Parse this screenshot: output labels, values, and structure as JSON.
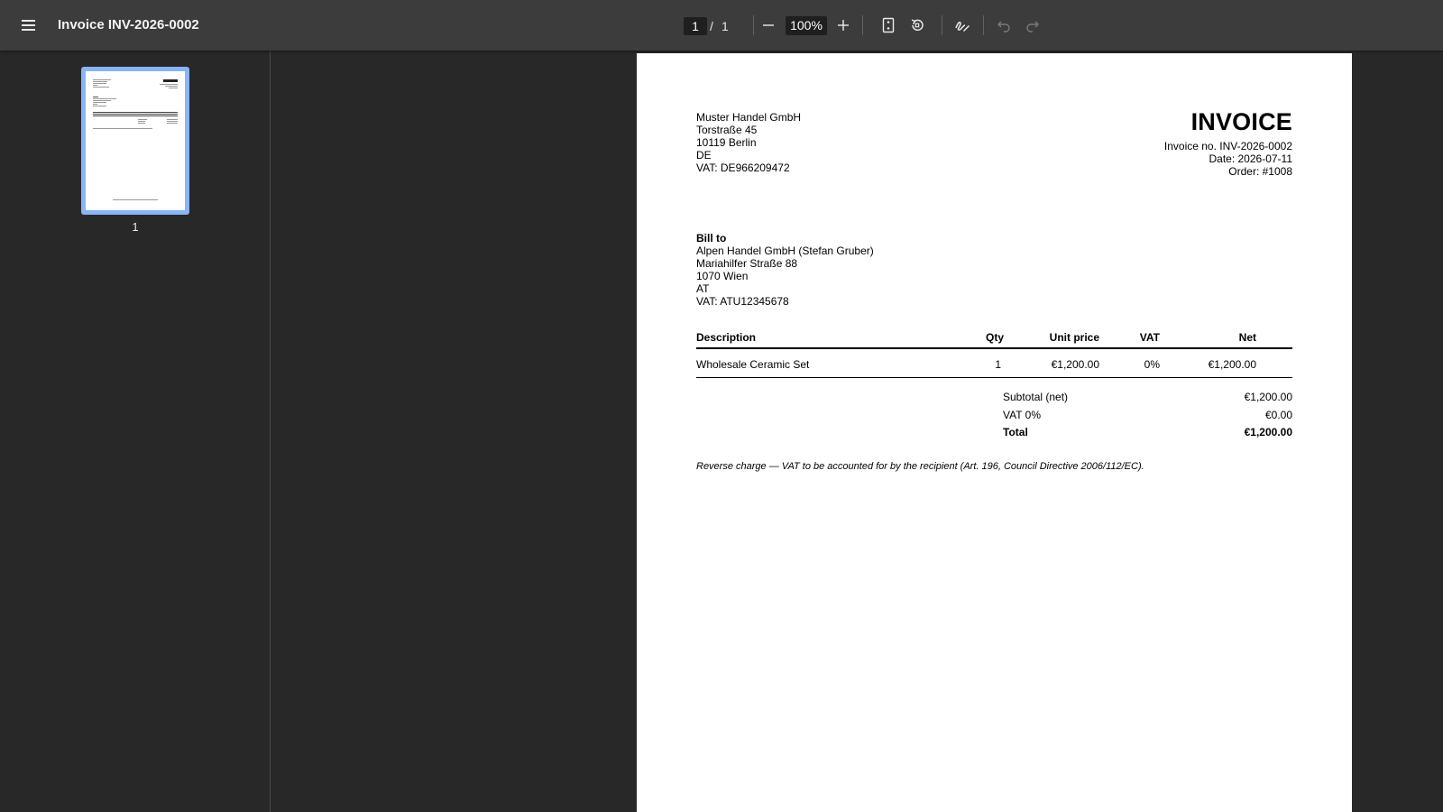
{
  "toolbar": {
    "title": "Invoice INV-2026-0002",
    "current_page": "1",
    "page_separator": "/",
    "total_pages": "1",
    "zoom": "100%"
  },
  "sidebar": {
    "thumbnails": [
      {
        "page_label": "1"
      }
    ]
  },
  "invoice": {
    "seller": {
      "name": "Muster Handel GmbH",
      "street": "Torstraße 45",
      "city": "10119 Berlin",
      "country": "DE",
      "vat": "VAT: DE966209472"
    },
    "title": "INVOICE",
    "meta": {
      "number": "Invoice no. INV-2026-0002",
      "date": "Date: 2026-07-11",
      "order": "Order: #1008"
    },
    "bill_to": {
      "heading": "Bill to",
      "name": "Alpen Handel GmbH (Stefan Gruber)",
      "street": "Mariahilfer Straße 88",
      "city": "1070 Wien",
      "country": "AT",
      "vat": "VAT: ATU12345678"
    },
    "table": {
      "headers": [
        "Description",
        "Qty",
        "Unit price",
        "VAT",
        "Net"
      ],
      "rows": [
        [
          "Wholesale Ceramic Set",
          "1",
          "€1,200.00",
          "0%",
          "€1,200.00"
        ]
      ]
    },
    "totals": [
      {
        "label": "Subtotal (net)",
        "value": "€1,200.00"
      },
      {
        "label": "VAT 0%",
        "value": "€0.00"
      },
      {
        "label": "Total",
        "value": "€1,200.00"
      }
    ],
    "note": "Reverse charge — VAT to be accounted for by the recipient (Art. 196, Council Directive 2006/112/EC)."
  }
}
